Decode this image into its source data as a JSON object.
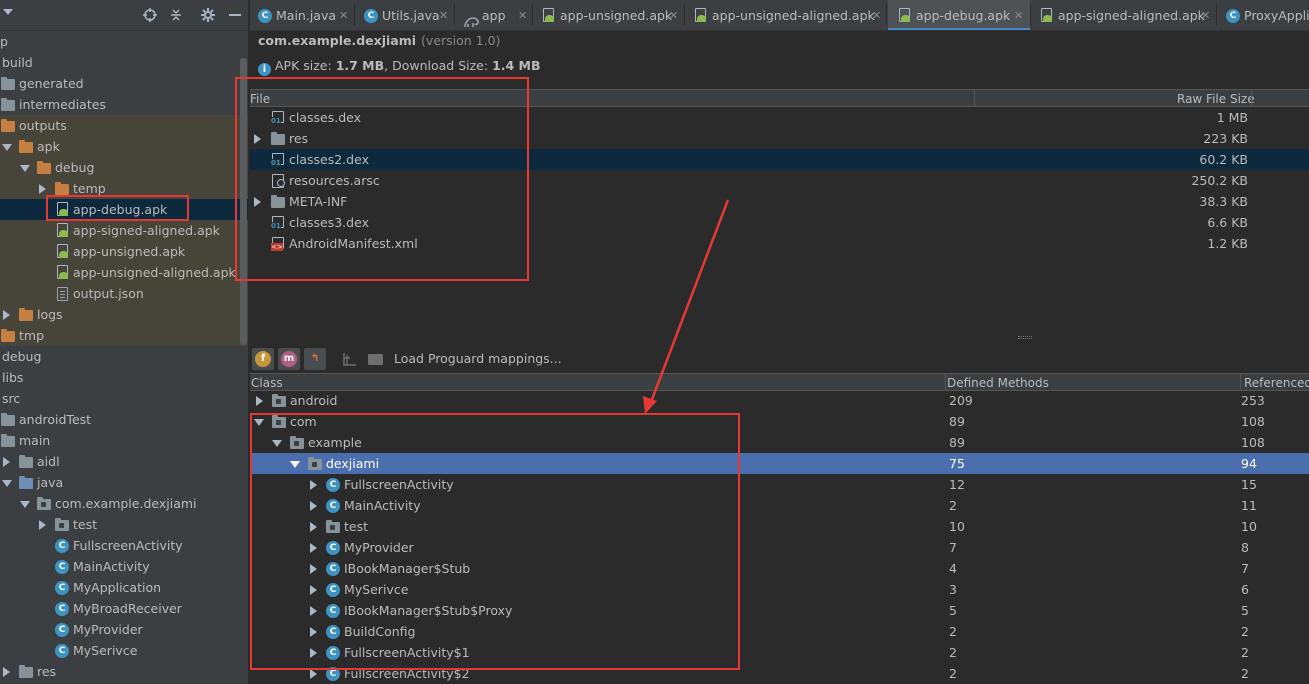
{
  "project_tree": {
    "items": [
      {
        "label": "p",
        "icon": "none"
      },
      {
        "label": "build",
        "icon": "folder-icon"
      },
      {
        "label": "generated",
        "icon": "folder-icon"
      },
      {
        "label": "intermediates",
        "icon": "folder-icon"
      },
      {
        "label": "outputs",
        "icon": "folder-icon"
      },
      {
        "label": "apk",
        "icon": "folder-icon"
      },
      {
        "label": "debug",
        "icon": "folder-icon"
      },
      {
        "label": "temp",
        "icon": "folder-icon"
      },
      {
        "label": "app-debug.apk",
        "icon": "apk-icon",
        "selected": true
      },
      {
        "label": "app-signed-aligned.apk",
        "icon": "apk-icon"
      },
      {
        "label": "app-unsigned.apk",
        "icon": "apk-icon"
      },
      {
        "label": "app-unsigned-aligned.apk",
        "icon": "apk-icon"
      },
      {
        "label": "output.json",
        "icon": "json-file-icon"
      },
      {
        "label": "logs",
        "icon": "folder-icon"
      },
      {
        "label": "tmp",
        "icon": "folder-icon"
      },
      {
        "label": "debug",
        "icon": "folder-icon"
      },
      {
        "label": "libs",
        "icon": "folder-icon"
      },
      {
        "label": "src",
        "icon": "folder-icon"
      },
      {
        "label": "androidTest",
        "icon": "folder-icon"
      },
      {
        "label": "main",
        "icon": "folder-icon"
      },
      {
        "label": "aidl",
        "icon": "folder-icon"
      },
      {
        "label": "java",
        "icon": "folder-icon"
      },
      {
        "label": "com.example.dexjiami",
        "icon": "package-icon"
      },
      {
        "label": "test",
        "icon": "package-icon"
      },
      {
        "label": "FullscreenActivity",
        "icon": "class-icon"
      },
      {
        "label": "MainActivity",
        "icon": "class-icon"
      },
      {
        "label": "MyApplication",
        "icon": "class-icon"
      },
      {
        "label": "MyBroadReceiver",
        "icon": "class-icon"
      },
      {
        "label": "MyProvider",
        "icon": "class-icon"
      },
      {
        "label": "MySerivce",
        "icon": "class-icon"
      },
      {
        "label": "res",
        "icon": "folder-icon"
      }
    ]
  },
  "tabs": [
    {
      "label": "Main.java",
      "icon": "java-class-icon"
    },
    {
      "label": "Utils.java",
      "icon": "java-class-icon"
    },
    {
      "label": "app",
      "icon": "gradle-icon"
    },
    {
      "label": "app-unsigned.apk",
      "icon": "apk-icon"
    },
    {
      "label": "app-unsigned-aligned.apk",
      "icon": "apk-icon"
    },
    {
      "label": "app-debug.apk",
      "icon": "apk-icon",
      "active": true
    },
    {
      "label": "app-signed-aligned.apk",
      "icon": "apk-icon"
    },
    {
      "label": "ProxyAppli",
      "icon": "java-class-icon"
    }
  ],
  "apk": {
    "package": "com.example.dexjiami",
    "version": "(version 1.0)",
    "size_prefix": "APK size: ",
    "size": "1.7 MB",
    "download_prefix": ", Download Size: ",
    "download_size": "1.4 MB"
  },
  "file_table": {
    "col_file": "File",
    "col_size": "Raw File Size",
    "rows": [
      {
        "name": "classes.dex",
        "size": "1 MB",
        "icon": "dex-file-icon"
      },
      {
        "name": "res",
        "size": "223 KB",
        "icon": "folder-icon",
        "expandable": true
      },
      {
        "name": "classes2.dex",
        "size": "60.2 KB",
        "icon": "dex-file-icon",
        "selected": true
      },
      {
        "name": "resources.arsc",
        "size": "250.2 KB",
        "icon": "arsc-file-icon"
      },
      {
        "name": "META-INF",
        "size": "38.3 KB",
        "icon": "folder-icon",
        "expandable": true
      },
      {
        "name": "classes3.dex",
        "size": "6.6 KB",
        "icon": "dex-file-icon"
      },
      {
        "name": "AndroidManifest.xml",
        "size": "1.2 KB",
        "icon": "xml-file-icon"
      }
    ]
  },
  "dex_toolbar": {
    "proguard_label": "Load Proguard mappings..."
  },
  "class_table": {
    "col_class": "Class",
    "col_defined": "Defined Methods",
    "col_referenced": "Referenced",
    "rows": [
      {
        "name": "android",
        "defined": "209",
        "referenced": "253",
        "icon": "package-icon"
      },
      {
        "name": "com",
        "defined": "89",
        "referenced": "108",
        "icon": "package-icon"
      },
      {
        "name": "example",
        "defined": "89",
        "referenced": "108",
        "icon": "package-icon"
      },
      {
        "name": "dexjiami",
        "defined": "75",
        "referenced": "94",
        "icon": "package-icon",
        "selected": true
      },
      {
        "name": "FullscreenActivity",
        "defined": "12",
        "referenced": "15",
        "icon": "class-icon"
      },
      {
        "name": "MainActivity",
        "defined": "2",
        "referenced": "11",
        "icon": "class-icon"
      },
      {
        "name": "test",
        "defined": "10",
        "referenced": "10",
        "icon": "package-icon"
      },
      {
        "name": "MyProvider",
        "defined": "7",
        "referenced": "8",
        "icon": "class-icon"
      },
      {
        "name": "IBookManager$Stub",
        "defined": "4",
        "referenced": "7",
        "icon": "class-icon"
      },
      {
        "name": "MySerivce",
        "defined": "3",
        "referenced": "6",
        "icon": "class-icon"
      },
      {
        "name": "IBookManager$Stub$Proxy",
        "defined": "5",
        "referenced": "5",
        "icon": "class-icon"
      },
      {
        "name": "BuildConfig",
        "defined": "2",
        "referenced": "2",
        "icon": "class-icon"
      },
      {
        "name": "FullscreenActivity$1",
        "defined": "2",
        "referenced": "2",
        "icon": "class-icon"
      },
      {
        "name": "FullscreenActivity$2",
        "defined": "2",
        "referenced": "2",
        "icon": "class-icon"
      }
    ]
  },
  "colors": {
    "accent": "#4a88c7",
    "selection": "#4b6eaf",
    "annotation": "#e53935"
  }
}
